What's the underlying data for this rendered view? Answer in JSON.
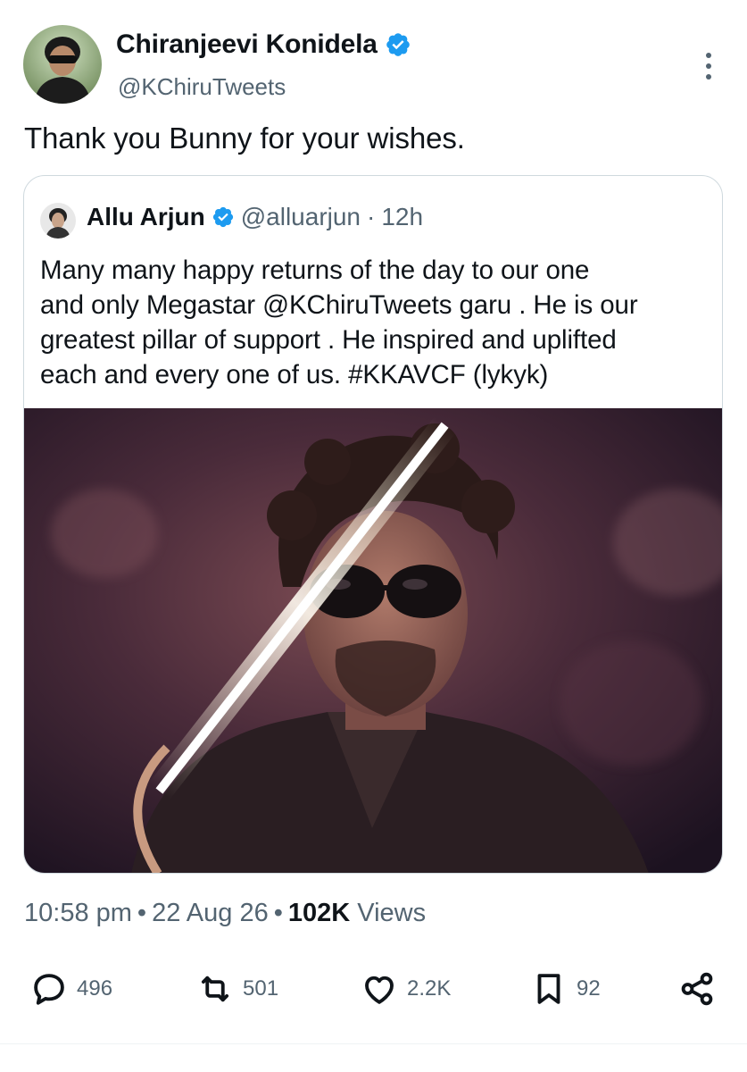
{
  "author": {
    "name": "Chiranjeevi Konidela",
    "handle": "@KChiruTweets",
    "verified": true
  },
  "tweet_text": "Thank you Bunny for your wishes.",
  "quoted": {
    "name": "Allu Arjun",
    "handle": "@alluarjun",
    "dot": "·",
    "time": "12h",
    "verified": true,
    "text_lines": [
      "Many many happy returns of the day to our one",
      "and only Megastar @KChiruTweets garu . He is our",
      "greatest pillar of support . He inspired and uplifted",
      "each and every one of us.  #KKAVCF (lykyk)"
    ]
  },
  "meta": {
    "time": "10:58 pm",
    "sep1": "•",
    "date": "22 Aug 26",
    "sep2": "•",
    "views_count": "102K",
    "views_label": "Views"
  },
  "actions": {
    "replies": "496",
    "reposts": "501",
    "likes": "2.2K",
    "bookmarks": "92"
  },
  "colors": {
    "text": "#0f1419",
    "secondary": "#536471",
    "verified": "#1d9bf0",
    "border": "#cfd9de"
  },
  "icons": [
    "verified-badge-icon",
    "more-options-icon",
    "reply-icon",
    "repost-icon",
    "like-icon",
    "bookmark-icon",
    "share-icon"
  ]
}
